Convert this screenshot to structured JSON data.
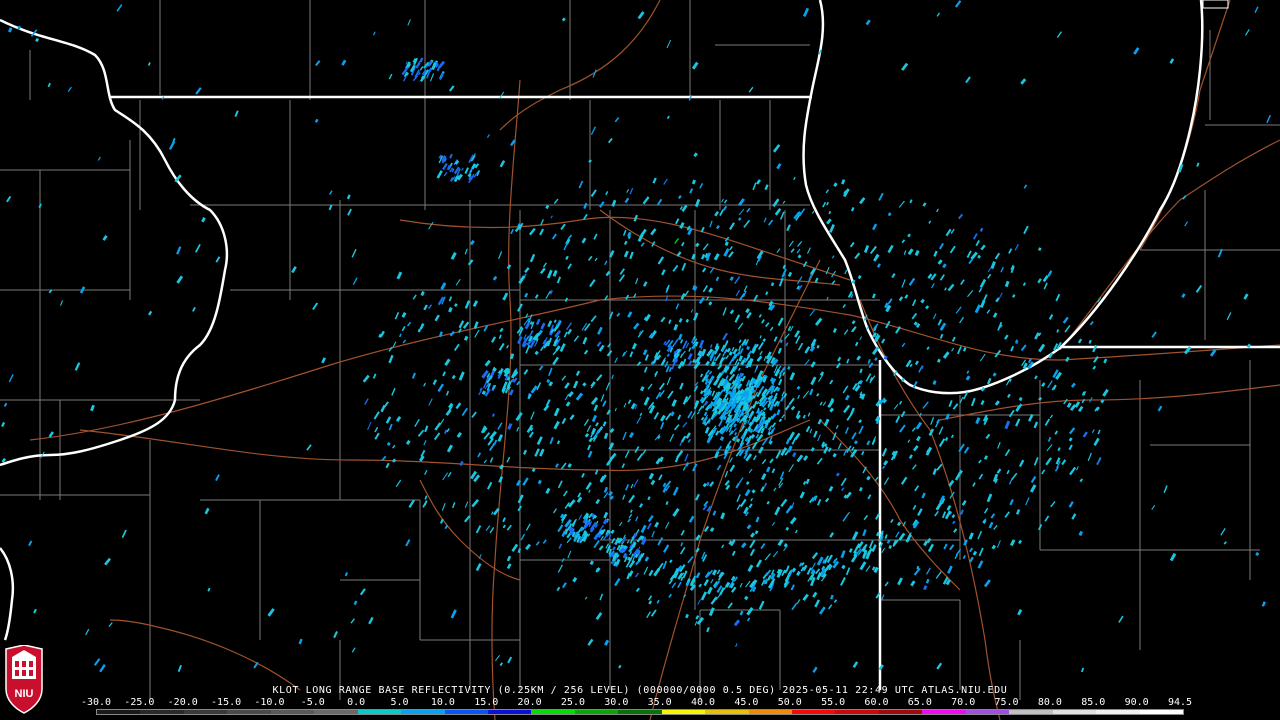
{
  "caption": "KLOT LONG RANGE BASE REFLECTIVITY (0.25KM / 256 LEVEL) (000000/0000 0.5 DEG) 2025-05-11 22:49 UTC  ATLAS.NIU.EDU",
  "scale": {
    "labels": [
      "-30.0",
      "-25.0",
      "-20.0",
      "-15.0",
      "-10.0",
      "-5.0",
      "0.0",
      "5.0",
      "10.0",
      "15.0",
      "20.0",
      "25.0",
      "30.0",
      "35.0",
      "40.0",
      "45.0",
      "50.0",
      "55.0",
      "60.0",
      "65.0",
      "70.0",
      "75.0",
      "80.0",
      "85.0",
      "90.0",
      "94.5"
    ],
    "colors": [
      "#1a1a1a",
      "#2a2a2a",
      "#3a3a3a",
      "#4a4a4a",
      "#5a5a5a",
      "#6a6a6a",
      "#0cc9c9",
      "#0aa0f0",
      "#0a55f0",
      "#0a10d8",
      "#0bd80b",
      "#09a509",
      "#0a700a",
      "#f6f60a",
      "#e8c00a",
      "#f08c0a",
      "#f00a0a",
      "#c80a0a",
      "#a00a0a",
      "#f00af0",
      "#a050e0",
      "#c0c0c0",
      "#e0e0e0",
      "#f0f0f0",
      "#ffffff",
      "#ffffff"
    ]
  },
  "logo": {
    "text": "NIU",
    "color": "#c8102e"
  },
  "map": {
    "background": "#000000",
    "state_border_color": "#ffffff",
    "county_line_color": "#7a7a7a",
    "highway_color": "#a0522d",
    "echo_colors": [
      "#19c8e0",
      "#0aa0f0",
      "#1a6cf0",
      "#0bd80b"
    ]
  }
}
